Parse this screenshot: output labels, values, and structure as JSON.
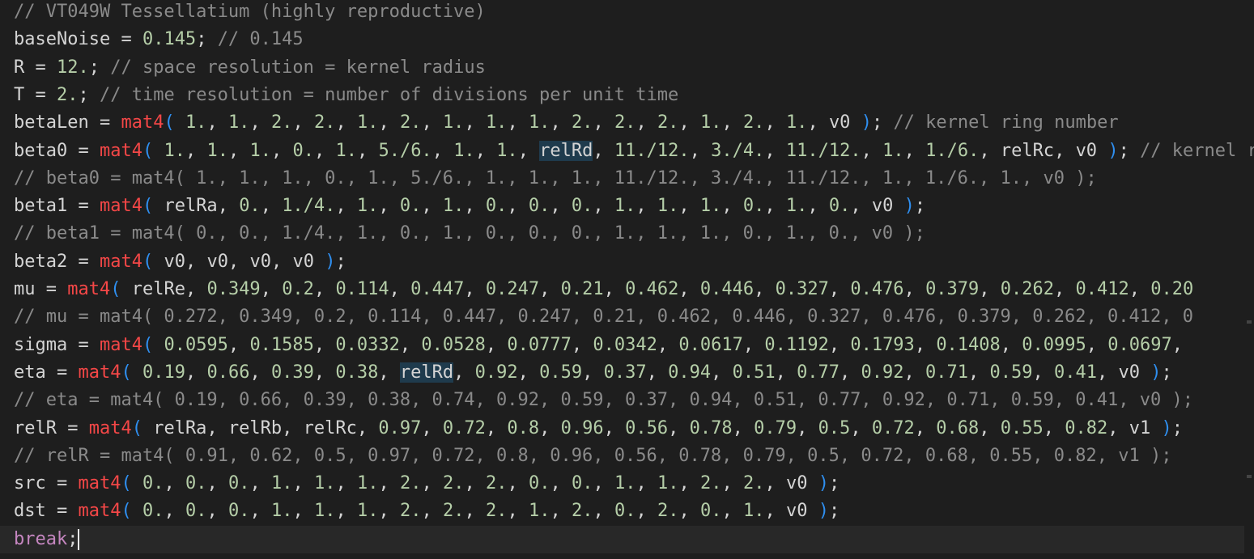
{
  "colors": {
    "background": "#1e1e1e",
    "current_line": "#282828",
    "comment": "#8a8a8a",
    "number": "#b5cea8",
    "function": "#f44747",
    "keyword": "#c586c0",
    "paren": "#2f8ff0",
    "text": "#d4d4d4",
    "selection_highlight": "#1f3b4d"
  },
  "lines": [
    [
      [
        "cmt",
        "// VT049W Tessellatium (highly reproductive)"
      ]
    ],
    [
      [
        "id",
        "baseNoise = "
      ],
      [
        "num",
        "0.145"
      ],
      [
        "pn",
        "; "
      ],
      [
        "cmt",
        "// 0.145"
      ]
    ],
    [
      [
        "id",
        "R = "
      ],
      [
        "num",
        "12."
      ],
      [
        "pn",
        "; "
      ],
      [
        "cmt",
        "// space resolution = kernel radius"
      ]
    ],
    [
      [
        "id",
        "T = "
      ],
      [
        "num",
        "2."
      ],
      [
        "pn",
        "; "
      ],
      [
        "cmt",
        "// time resolution = number of divisions per unit time"
      ]
    ],
    [
      [
        "id",
        "betaLen = "
      ],
      [
        "fn",
        "mat4"
      ],
      [
        "pr",
        "("
      ],
      [
        "pn",
        " "
      ],
      [
        "num",
        "1."
      ],
      [
        "pn",
        ", "
      ],
      [
        "num",
        "1."
      ],
      [
        "pn",
        ", "
      ],
      [
        "num",
        "2."
      ],
      [
        "pn",
        ", "
      ],
      [
        "num",
        "2."
      ],
      [
        "pn",
        ", "
      ],
      [
        "num",
        "1."
      ],
      [
        "pn",
        ", "
      ],
      [
        "num",
        "2."
      ],
      [
        "pn",
        ", "
      ],
      [
        "num",
        "1."
      ],
      [
        "pn",
        ", "
      ],
      [
        "num",
        "1."
      ],
      [
        "pn",
        ", "
      ],
      [
        "num",
        "1."
      ],
      [
        "pn",
        ", "
      ],
      [
        "num",
        "2."
      ],
      [
        "pn",
        ", "
      ],
      [
        "num",
        "2."
      ],
      [
        "pn",
        ", "
      ],
      [
        "num",
        "2."
      ],
      [
        "pn",
        ", "
      ],
      [
        "num",
        "1."
      ],
      [
        "pn",
        ", "
      ],
      [
        "num",
        "2."
      ],
      [
        "pn",
        ", "
      ],
      [
        "num",
        "1."
      ],
      [
        "pn",
        ", "
      ],
      [
        "id",
        "v0"
      ],
      [
        "pn",
        " "
      ],
      [
        "pr",
        ")"
      ],
      [
        "pn",
        "; "
      ],
      [
        "cmt",
        "// kernel ring number"
      ]
    ],
    [
      [
        "id",
        "beta0 = "
      ],
      [
        "fn",
        "mat4"
      ],
      [
        "pr",
        "("
      ],
      [
        "pn",
        " "
      ],
      [
        "num",
        "1."
      ],
      [
        "pn",
        ", "
      ],
      [
        "num",
        "1."
      ],
      [
        "pn",
        ", "
      ],
      [
        "num",
        "1."
      ],
      [
        "pn",
        ", "
      ],
      [
        "num",
        "0."
      ],
      [
        "pn",
        ", "
      ],
      [
        "num",
        "1."
      ],
      [
        "pn",
        ", "
      ],
      [
        "num",
        "5./6."
      ],
      [
        "pn",
        ", "
      ],
      [
        "num",
        "1."
      ],
      [
        "pn",
        ", "
      ],
      [
        "num",
        "1."
      ],
      [
        "pn",
        ", "
      ],
      [
        "hl",
        "relRd"
      ],
      [
        "pn",
        ", "
      ],
      [
        "num",
        "11./12."
      ],
      [
        "pn",
        ", "
      ],
      [
        "num",
        "3./4."
      ],
      [
        "pn",
        ", "
      ],
      [
        "num",
        "11./12."
      ],
      [
        "pn",
        ", "
      ],
      [
        "num",
        "1."
      ],
      [
        "pn",
        ", "
      ],
      [
        "num",
        "1./6."
      ],
      [
        "pn",
        ", "
      ],
      [
        "id",
        "relRc"
      ],
      [
        "pn",
        ", "
      ],
      [
        "id",
        "v0"
      ],
      [
        "pn",
        " "
      ],
      [
        "pr",
        ")"
      ],
      [
        "pn",
        "; "
      ],
      [
        "cmt",
        "// kernel ring heights"
      ]
    ],
    [
      [
        "cmt",
        "// beta0 = mat4( 1., 1., 1., 0., 1., 5./6., 1., 1., 1., 11./12., 3./4., 11./12., 1., 1./6., 1., v0 );"
      ]
    ],
    [
      [
        "id",
        "beta1 = "
      ],
      [
        "fn",
        "mat4"
      ],
      [
        "pr",
        "("
      ],
      [
        "pn",
        " "
      ],
      [
        "id",
        "relRa"
      ],
      [
        "pn",
        ", "
      ],
      [
        "num",
        "0."
      ],
      [
        "pn",
        ", "
      ],
      [
        "num",
        "1./4."
      ],
      [
        "pn",
        ", "
      ],
      [
        "num",
        "1."
      ],
      [
        "pn",
        ", "
      ],
      [
        "num",
        "0."
      ],
      [
        "pn",
        ", "
      ],
      [
        "num",
        "1."
      ],
      [
        "pn",
        ", "
      ],
      [
        "num",
        "0."
      ],
      [
        "pn",
        ", "
      ],
      [
        "num",
        "0."
      ],
      [
        "pn",
        ", "
      ],
      [
        "num",
        "0."
      ],
      [
        "pn",
        ", "
      ],
      [
        "num",
        "1."
      ],
      [
        "pn",
        ", "
      ],
      [
        "num",
        "1."
      ],
      [
        "pn",
        ", "
      ],
      [
        "num",
        "1."
      ],
      [
        "pn",
        ", "
      ],
      [
        "num",
        "0."
      ],
      [
        "pn",
        ", "
      ],
      [
        "num",
        "1."
      ],
      [
        "pn",
        ", "
      ],
      [
        "num",
        "0."
      ],
      [
        "pn",
        ", "
      ],
      [
        "id",
        "v0"
      ],
      [
        "pn",
        " "
      ],
      [
        "pr",
        ")"
      ],
      [
        "pn",
        ";"
      ]
    ],
    [
      [
        "cmt",
        "// beta1 = mat4( 0., 0., 1./4., 1., 0., 1., 0., 0., 0., 1., 1., 1., 0., 1., 0., v0 );"
      ]
    ],
    [
      [
        "id",
        "beta2 = "
      ],
      [
        "fn",
        "mat4"
      ],
      [
        "pr",
        "("
      ],
      [
        "pn",
        " "
      ],
      [
        "id",
        "v0"
      ],
      [
        "pn",
        ", "
      ],
      [
        "id",
        "v0"
      ],
      [
        "pn",
        ", "
      ],
      [
        "id",
        "v0"
      ],
      [
        "pn",
        ", "
      ],
      [
        "id",
        "v0"
      ],
      [
        "pn",
        " "
      ],
      [
        "pr",
        ")"
      ],
      [
        "pn",
        ";"
      ]
    ],
    [
      [
        "id",
        "mu = "
      ],
      [
        "fn",
        "mat4"
      ],
      [
        "pr",
        "("
      ],
      [
        "pn",
        " "
      ],
      [
        "id",
        "relRe"
      ],
      [
        "pn",
        ", "
      ],
      [
        "num",
        "0.349"
      ],
      [
        "pn",
        ", "
      ],
      [
        "num",
        "0.2"
      ],
      [
        "pn",
        ", "
      ],
      [
        "num",
        "0.114"
      ],
      [
        "pn",
        ", "
      ],
      [
        "num",
        "0.447"
      ],
      [
        "pn",
        ", "
      ],
      [
        "num",
        "0.247"
      ],
      [
        "pn",
        ", "
      ],
      [
        "num",
        "0.21"
      ],
      [
        "pn",
        ", "
      ],
      [
        "num",
        "0.462"
      ],
      [
        "pn",
        ", "
      ],
      [
        "num",
        "0.446"
      ],
      [
        "pn",
        ", "
      ],
      [
        "num",
        "0.327"
      ],
      [
        "pn",
        ", "
      ],
      [
        "num",
        "0.476"
      ],
      [
        "pn",
        ", "
      ],
      [
        "num",
        "0.379"
      ],
      [
        "pn",
        ", "
      ],
      [
        "num",
        "0.262"
      ],
      [
        "pn",
        ", "
      ],
      [
        "num",
        "0.412"
      ],
      [
        "pn",
        ", "
      ],
      [
        "num",
        "0.20"
      ]
    ],
    [
      [
        "cmt",
        "// mu = mat4( 0.272, 0.349, 0.2, 0.114, 0.447, 0.247, 0.21, 0.462, 0.446, 0.327, 0.476, 0.379, 0.262, 0.412, 0"
      ]
    ],
    [
      [
        "id",
        "sigma = "
      ],
      [
        "fn",
        "mat4"
      ],
      [
        "pr",
        "("
      ],
      [
        "pn",
        " "
      ],
      [
        "num",
        "0.0595"
      ],
      [
        "pn",
        ", "
      ],
      [
        "num",
        "0.1585"
      ],
      [
        "pn",
        ", "
      ],
      [
        "num",
        "0.0332"
      ],
      [
        "pn",
        ", "
      ],
      [
        "num",
        "0.0528"
      ],
      [
        "pn",
        ", "
      ],
      [
        "num",
        "0.0777"
      ],
      [
        "pn",
        ", "
      ],
      [
        "num",
        "0.0342"
      ],
      [
        "pn",
        ", "
      ],
      [
        "num",
        "0.0617"
      ],
      [
        "pn",
        ", "
      ],
      [
        "num",
        "0.1192"
      ],
      [
        "pn",
        ", "
      ],
      [
        "num",
        "0.1793"
      ],
      [
        "pn",
        ", "
      ],
      [
        "num",
        "0.1408"
      ],
      [
        "pn",
        ", "
      ],
      [
        "num",
        "0.0995"
      ],
      [
        "pn",
        ", "
      ],
      [
        "num",
        "0.0697"
      ],
      [
        "pn",
        ","
      ]
    ],
    [
      [
        "id",
        "eta = "
      ],
      [
        "fn",
        "mat4"
      ],
      [
        "pr",
        "("
      ],
      [
        "pn",
        " "
      ],
      [
        "num",
        "0.19"
      ],
      [
        "pn",
        ", "
      ],
      [
        "num",
        "0.66"
      ],
      [
        "pn",
        ", "
      ],
      [
        "num",
        "0.39"
      ],
      [
        "pn",
        ", "
      ],
      [
        "num",
        "0.38"
      ],
      [
        "pn",
        ", "
      ],
      [
        "hl",
        "relRd"
      ],
      [
        "pn",
        ", "
      ],
      [
        "num",
        "0.92"
      ],
      [
        "pn",
        ", "
      ],
      [
        "num",
        "0.59"
      ],
      [
        "pn",
        ", "
      ],
      [
        "num",
        "0.37"
      ],
      [
        "pn",
        ", "
      ],
      [
        "num",
        "0.94"
      ],
      [
        "pn",
        ", "
      ],
      [
        "num",
        "0.51"
      ],
      [
        "pn",
        ", "
      ],
      [
        "num",
        "0.77"
      ],
      [
        "pn",
        ", "
      ],
      [
        "num",
        "0.92"
      ],
      [
        "pn",
        ", "
      ],
      [
        "num",
        "0.71"
      ],
      [
        "pn",
        ", "
      ],
      [
        "num",
        "0.59"
      ],
      [
        "pn",
        ", "
      ],
      [
        "num",
        "0.41"
      ],
      [
        "pn",
        ", "
      ],
      [
        "id",
        "v0"
      ],
      [
        "pn",
        " "
      ],
      [
        "pr",
        ")"
      ],
      [
        "pn",
        ";"
      ]
    ],
    [
      [
        "cmt",
        "// eta = mat4( 0.19, 0.66, 0.39, 0.38, 0.74, 0.92, 0.59, 0.37, 0.94, 0.51, 0.77, 0.92, 0.71, 0.59, 0.41, v0 );"
      ]
    ],
    [
      [
        "id",
        "relR = "
      ],
      [
        "fn",
        "mat4"
      ],
      [
        "pr",
        "("
      ],
      [
        "pn",
        " "
      ],
      [
        "id",
        "relRa"
      ],
      [
        "pn",
        ", "
      ],
      [
        "id",
        "relRb"
      ],
      [
        "pn",
        ", "
      ],
      [
        "id",
        "relRc"
      ],
      [
        "pn",
        ", "
      ],
      [
        "num",
        "0.97"
      ],
      [
        "pn",
        ", "
      ],
      [
        "num",
        "0.72"
      ],
      [
        "pn",
        ", "
      ],
      [
        "num",
        "0.8"
      ],
      [
        "pn",
        ", "
      ],
      [
        "num",
        "0.96"
      ],
      [
        "pn",
        ", "
      ],
      [
        "num",
        "0.56"
      ],
      [
        "pn",
        ", "
      ],
      [
        "num",
        "0.78"
      ],
      [
        "pn",
        ", "
      ],
      [
        "num",
        "0.79"
      ],
      [
        "pn",
        ", "
      ],
      [
        "num",
        "0.5"
      ],
      [
        "pn",
        ", "
      ],
      [
        "num",
        "0.72"
      ],
      [
        "pn",
        ", "
      ],
      [
        "num",
        "0.68"
      ],
      [
        "pn",
        ", "
      ],
      [
        "num",
        "0.55"
      ],
      [
        "pn",
        ", "
      ],
      [
        "num",
        "0.82"
      ],
      [
        "pn",
        ", "
      ],
      [
        "id",
        "v1"
      ],
      [
        "pn",
        " "
      ],
      [
        "pr",
        ")"
      ],
      [
        "pn",
        ";"
      ]
    ],
    [
      [
        "cmt",
        "// relR = mat4( 0.91, 0.62, 0.5, 0.97, 0.72, 0.8, 0.96, 0.56, 0.78, 0.79, 0.5, 0.72, 0.68, 0.55, 0.82, v1 );"
      ]
    ],
    [
      [
        "id",
        "src = "
      ],
      [
        "fn",
        "mat4"
      ],
      [
        "pr",
        "("
      ],
      [
        "pn",
        " "
      ],
      [
        "num",
        "0."
      ],
      [
        "pn",
        ", "
      ],
      [
        "num",
        "0."
      ],
      [
        "pn",
        ", "
      ],
      [
        "num",
        "0."
      ],
      [
        "pn",
        ", "
      ],
      [
        "num",
        "1."
      ],
      [
        "pn",
        ", "
      ],
      [
        "num",
        "1."
      ],
      [
        "pn",
        ", "
      ],
      [
        "num",
        "1."
      ],
      [
        "pn",
        ", "
      ],
      [
        "num",
        "2."
      ],
      [
        "pn",
        ", "
      ],
      [
        "num",
        "2."
      ],
      [
        "pn",
        ", "
      ],
      [
        "num",
        "2."
      ],
      [
        "pn",
        ", "
      ],
      [
        "num",
        "0."
      ],
      [
        "pn",
        ", "
      ],
      [
        "num",
        "0."
      ],
      [
        "pn",
        ", "
      ],
      [
        "num",
        "1."
      ],
      [
        "pn",
        ", "
      ],
      [
        "num",
        "1."
      ],
      [
        "pn",
        ", "
      ],
      [
        "num",
        "2."
      ],
      [
        "pn",
        ", "
      ],
      [
        "num",
        "2."
      ],
      [
        "pn",
        ", "
      ],
      [
        "id",
        "v0"
      ],
      [
        "pn",
        " "
      ],
      [
        "pr",
        ")"
      ],
      [
        "pn",
        ";"
      ]
    ],
    [
      [
        "id",
        "dst = "
      ],
      [
        "fn",
        "mat4"
      ],
      [
        "pr",
        "("
      ],
      [
        "pn",
        " "
      ],
      [
        "num",
        "0."
      ],
      [
        "pn",
        ", "
      ],
      [
        "num",
        "0."
      ],
      [
        "pn",
        ", "
      ],
      [
        "num",
        "0."
      ],
      [
        "pn",
        ", "
      ],
      [
        "num",
        "1."
      ],
      [
        "pn",
        ", "
      ],
      [
        "num",
        "1."
      ],
      [
        "pn",
        ", "
      ],
      [
        "num",
        "1."
      ],
      [
        "pn",
        ", "
      ],
      [
        "num",
        "2."
      ],
      [
        "pn",
        ", "
      ],
      [
        "num",
        "2."
      ],
      [
        "pn",
        ", "
      ],
      [
        "num",
        "2."
      ],
      [
        "pn",
        ", "
      ],
      [
        "num",
        "1."
      ],
      [
        "pn",
        ", "
      ],
      [
        "num",
        "2."
      ],
      [
        "pn",
        ", "
      ],
      [
        "num",
        "0."
      ],
      [
        "pn",
        ", "
      ],
      [
        "num",
        "2."
      ],
      [
        "pn",
        ", "
      ],
      [
        "num",
        "0."
      ],
      [
        "pn",
        ", "
      ],
      [
        "num",
        "1."
      ],
      [
        "pn",
        ", "
      ],
      [
        "id",
        "v0"
      ],
      [
        "pn",
        " "
      ],
      [
        "pr",
        ")"
      ],
      [
        "pn",
        ";"
      ]
    ],
    [
      [
        "kw",
        "break"
      ],
      [
        "pn",
        ";"
      ]
    ]
  ],
  "cursor_line": 19
}
